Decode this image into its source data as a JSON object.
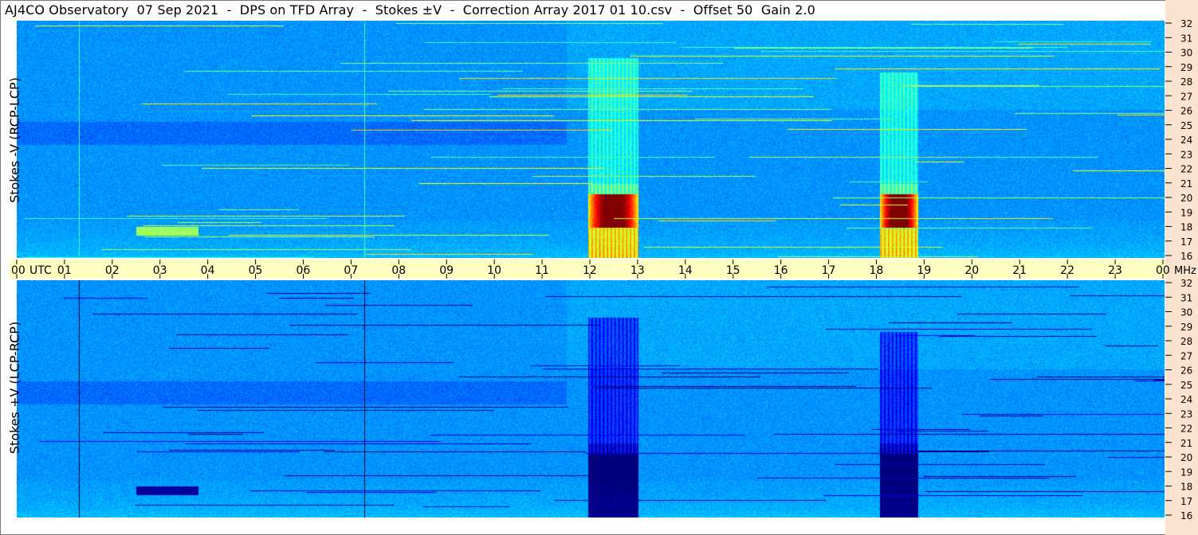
{
  "window": {
    "title": "AJ4CO Observatory  07 Sep 2021  -  DPS on TFD Array  -  Stokes ±V  -  Correction Array 2017 01 10.csv  -  Offset 50  Gain 2.0"
  },
  "colors": {
    "background": "#ffffff",
    "time_axis_band": "#ffffc4",
    "freq_axis_band": "#fde4d0",
    "spectrogram_base": "#1a5fe0",
    "spectrogram_hot": "#ff3030"
  },
  "chart_data": [
    {
      "type": "heatmap",
      "ylabel": "Stokes -V (RCP-LCP)",
      "x": {
        "ticks": [
          "00",
          "01",
          "02",
          "03",
          "04",
          "05",
          "06",
          "07",
          "08",
          "09",
          "10",
          "11",
          "12",
          "13",
          "14",
          "15",
          "16",
          "17",
          "18",
          "19",
          "20",
          "21",
          "22",
          "23",
          "00"
        ],
        "unit": "UTC",
        "range": [
          0,
          24
        ]
      },
      "y": {
        "ticks": [
          "16",
          "17",
          "18",
          "19",
          "20",
          "21",
          "22",
          "23",
          "24",
          "25",
          "26",
          "27",
          "28",
          "29",
          "30",
          "31",
          "32"
        ],
        "unit": "MHz",
        "range": [
          16,
          32
        ]
      },
      "events": [
        {
          "start_utc": 11.95,
          "end_utc": 13.0,
          "fmin": 16,
          "fmax": 29.5,
          "peak": "high"
        },
        {
          "start_utc": 18.05,
          "end_utc": 18.85,
          "fmin": 16,
          "fmax": 28.5,
          "peak": "high"
        }
      ],
      "polarity": "positive"
    },
    {
      "type": "heatmap",
      "ylabel": "Stokes +V (LCP-RCP)",
      "x": {
        "ticks": [
          "00",
          "01",
          "02",
          "03",
          "04",
          "05",
          "06",
          "07",
          "08",
          "09",
          "10",
          "11",
          "12",
          "13",
          "14",
          "15",
          "16",
          "17",
          "18",
          "19",
          "20",
          "21",
          "22",
          "23",
          "00"
        ],
        "unit": "UTC",
        "range": [
          0,
          24
        ]
      },
      "y": {
        "ticks": [
          "16",
          "17",
          "18",
          "19",
          "20",
          "21",
          "22",
          "23",
          "24",
          "25",
          "26",
          "27",
          "28",
          "29",
          "30",
          "31",
          "32"
        ],
        "unit": "MHz",
        "range": [
          16,
          32
        ]
      },
      "events": [
        {
          "start_utc": 11.95,
          "end_utc": 13.0,
          "fmin": 16,
          "fmax": 29.5,
          "peak": "low"
        },
        {
          "start_utc": 18.05,
          "end_utc": 18.85,
          "fmin": 16,
          "fmax": 28.5,
          "peak": "low"
        }
      ],
      "polarity": "negative"
    }
  ]
}
